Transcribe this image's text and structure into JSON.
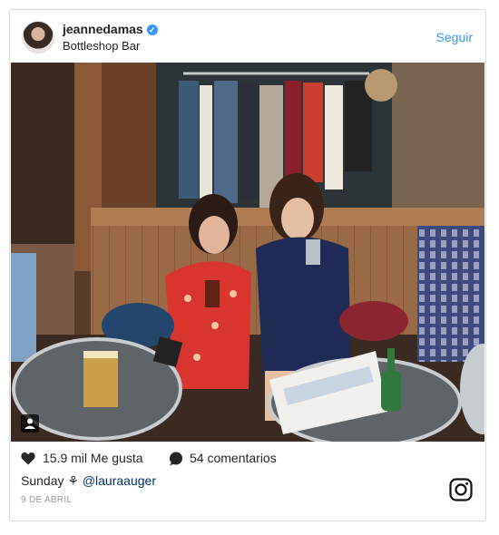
{
  "post": {
    "username": "jeannedamas",
    "location": "Bottleshop Bar",
    "follow_label": "Seguir",
    "likes": "15.9 mil Me gusta",
    "comments": "54 comentarios",
    "caption_text": "Sunday",
    "caption_flower": "⚘",
    "caption_mention": "@lauraauger",
    "date": "9 DE ABRIL"
  },
  "colors": {
    "accent": "#3897f0",
    "text": "#262626",
    "muted": "#999999"
  },
  "icons": {
    "verified": "verified-badge-icon",
    "like": "heart-icon",
    "comment": "comment-icon",
    "brand": "instagram-icon",
    "tag": "user-tag-icon"
  }
}
